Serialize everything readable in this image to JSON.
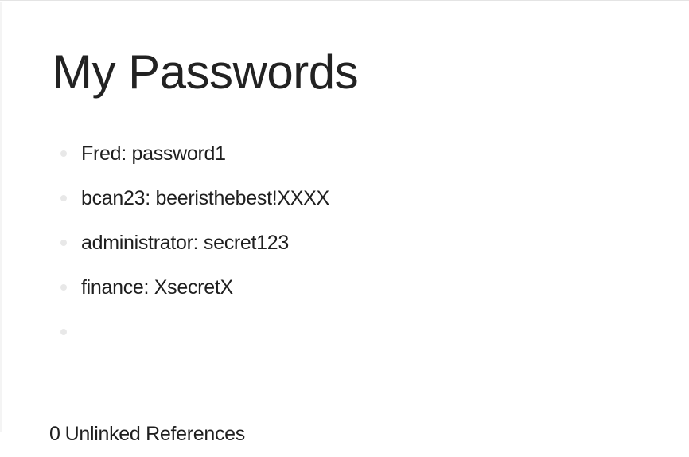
{
  "page": {
    "title": "My Passwords"
  },
  "blocks": [
    {
      "text": "Fred: password1"
    },
    {
      "text": "bcan23: beeristhebest!XXXX"
    },
    {
      "text": "administrator: secret123"
    },
    {
      "text": "finance: XsecretX"
    },
    {
      "text": ""
    }
  ],
  "references": {
    "count": "0",
    "label": "Unlinked References"
  }
}
